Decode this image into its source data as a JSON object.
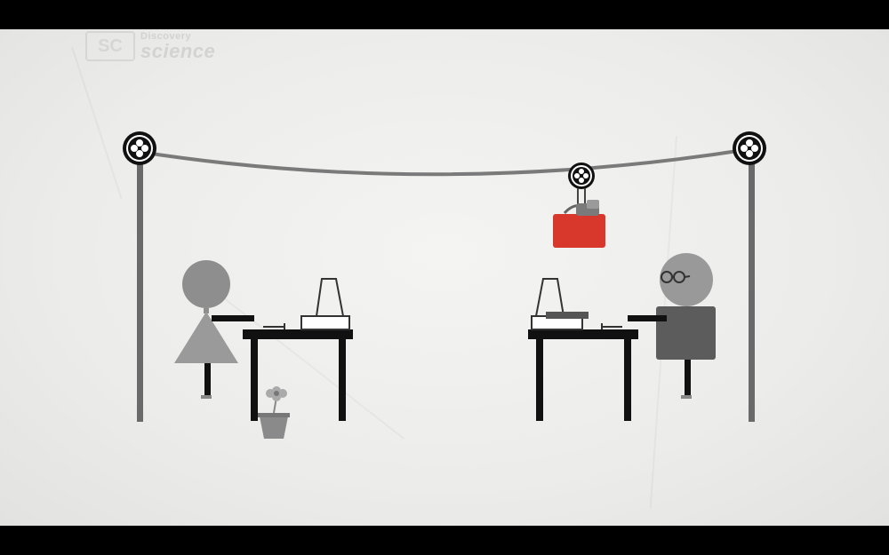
{
  "channel_logo": {
    "badge": "SC",
    "line1": "Discovery",
    "line2": "science"
  },
  "scene": {
    "colors": {
      "paper": "#eeeeec",
      "ink": "#111111",
      "figure_gray": "#8e8e8e",
      "dark_gray": "#5c5c5c",
      "bag_red": "#d8372b",
      "wire": "#7a7a7a"
    },
    "icons": [
      "pulley-icon",
      "woman-figure",
      "man-figure-with-glasses",
      "desk",
      "computer",
      "flower-pot",
      "red-bag"
    ]
  }
}
